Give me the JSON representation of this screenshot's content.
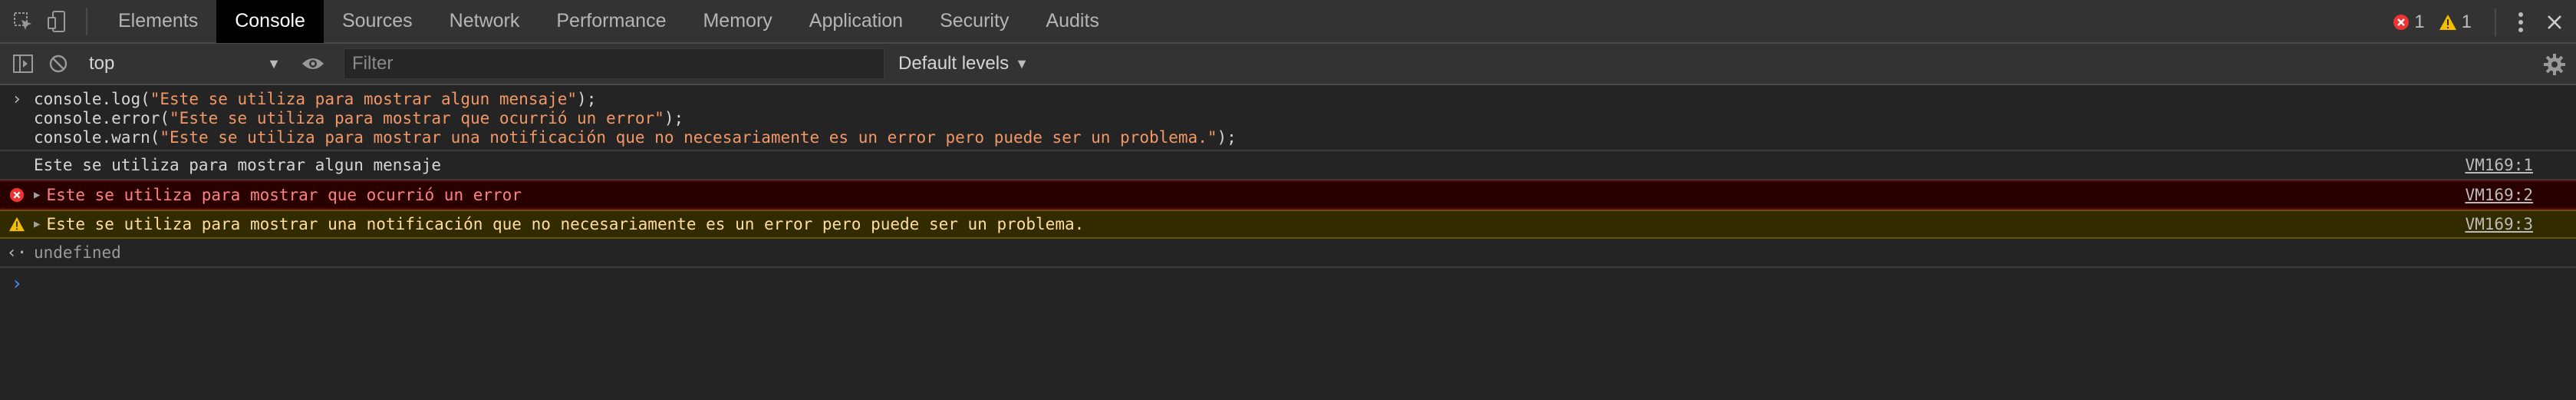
{
  "toolbar": {
    "tabs": [
      "Elements",
      "Console",
      "Sources",
      "Network",
      "Performance",
      "Memory",
      "Application",
      "Security",
      "Audits"
    ],
    "active_tab": "Console",
    "error_count": "1",
    "warning_count": "1"
  },
  "console_toolbar": {
    "context": "top",
    "filter_placeholder": "Filter",
    "levels": "Default levels"
  },
  "input": {
    "line1": {
      "obj": "console.",
      "fn": "log",
      "open": "(",
      "str": "\"Este se utiliza para mostrar algun mensaje\"",
      "close": ");"
    },
    "line2": {
      "obj": "console.",
      "fn": "error",
      "open": "(",
      "str": "\"Este se utiliza para mostrar que ocurrió un error\"",
      "close": ");"
    },
    "line3": {
      "obj": "console.",
      "fn": "warn",
      "open": "(",
      "str": "\"Este se utiliza para mostrar una notificación que no necesariamente es un error pero puede ser un problema.\"",
      "close": ");"
    }
  },
  "messages": {
    "log": {
      "text": "Este se utiliza para mostrar algun mensaje",
      "source": "VM169:1"
    },
    "error": {
      "text": "Este se utiliza para mostrar que ocurrió un error",
      "source": "VM169:2"
    },
    "warn": {
      "text": "Este se utiliza para mostrar una notificación que no necesariamente es un error pero puede ser un problema.",
      "source": "VM169:3"
    }
  },
  "result": {
    "text": "undefined"
  },
  "colors": {
    "error": "#ff8080",
    "warning": "#ffdd9e",
    "string": "#f29766",
    "prompt": "#4d8ff5"
  }
}
